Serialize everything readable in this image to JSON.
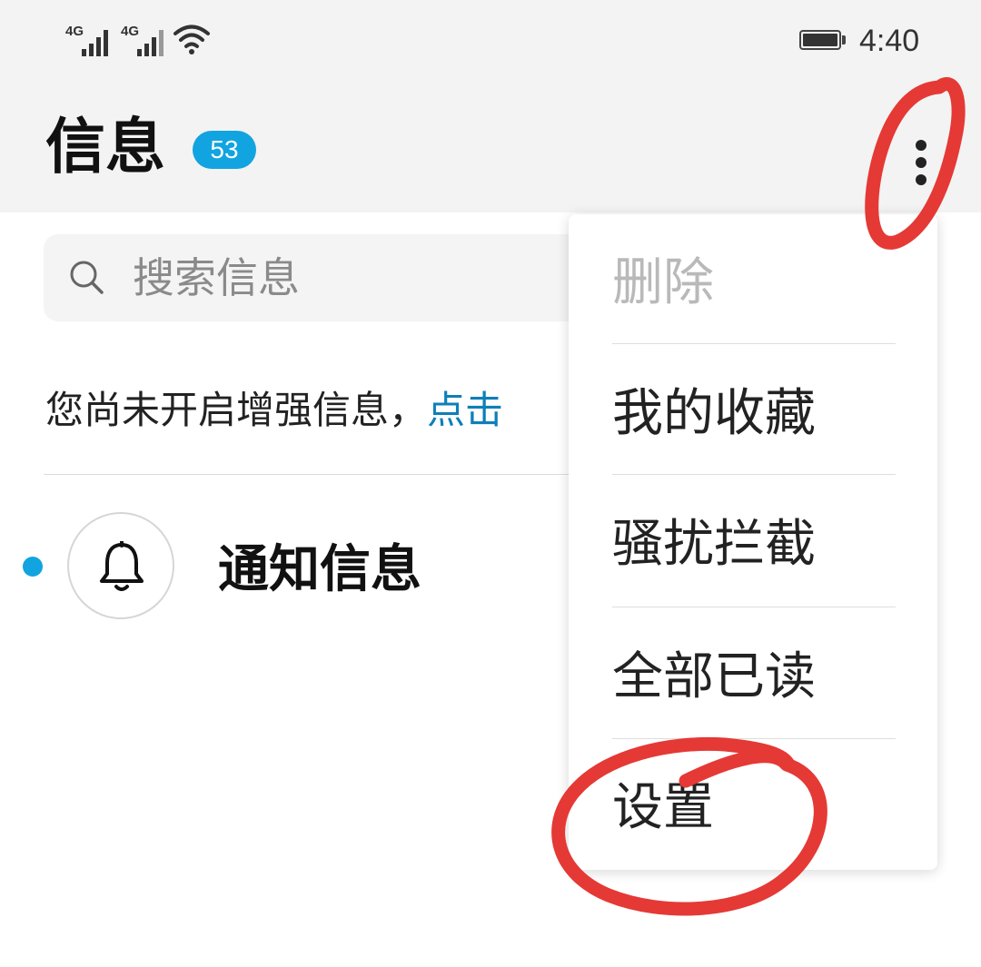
{
  "status_bar": {
    "network_1": "4G",
    "network_2": "4G",
    "time": "4:40",
    "icons": [
      "signal-icon",
      "signal-icon",
      "wifi-icon",
      "battery-icon"
    ]
  },
  "header": {
    "title": "信息",
    "unread_count": "53",
    "more_icon": "more-vertical-icon"
  },
  "search": {
    "placeholder": "搜索信息",
    "icon": "search-icon"
  },
  "notice": {
    "text": "您尚未开启增强信息，",
    "link": "点击"
  },
  "conversations": [
    {
      "title": "通知信息",
      "icon": "bell-icon",
      "unread": true
    }
  ],
  "menu": {
    "items": [
      {
        "label": "删除",
        "enabled": false
      },
      {
        "label": "我的收藏",
        "enabled": true
      },
      {
        "label": "骚扰拦截",
        "enabled": true
      },
      {
        "label": "全部已读",
        "enabled": true
      },
      {
        "label": "设置",
        "enabled": true
      }
    ]
  },
  "colors": {
    "accent": "#11a4e0",
    "link": "#0e7fb8",
    "annotation": "#e53935",
    "header_bg": "#f3f3f3"
  }
}
